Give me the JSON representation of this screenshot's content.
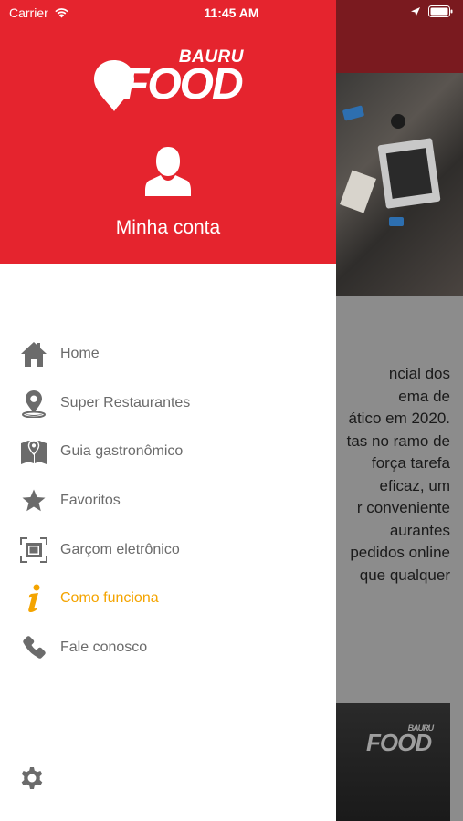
{
  "status_bar": {
    "carrier": "Carrier",
    "time": "11:45 AM"
  },
  "drawer": {
    "logo": {
      "top_text": "BAURU",
      "main_text": "FOOD"
    },
    "account_label": "Minha conta",
    "menu": [
      {
        "label": "Home",
        "icon": "home-icon",
        "active": false
      },
      {
        "label": "Super Restaurantes",
        "icon": "map-pin-icon",
        "active": false
      },
      {
        "label": "Guia gastronômico",
        "icon": "map-guide-icon",
        "active": false
      },
      {
        "label": "Favoritos",
        "icon": "star-icon",
        "active": false
      },
      {
        "label": "Garçom eletrônico",
        "icon": "scan-icon",
        "active": false
      },
      {
        "label": "Como funciona",
        "icon": "info-icon",
        "active": true
      },
      {
        "label": "Fale conosco",
        "icon": "phone-icon",
        "active": false
      }
    ],
    "settings_icon": "gear-icon"
  },
  "background": {
    "text_lines": [
      "ncial dos",
      "ema de",
      "ático em 2020.",
      "tas no ramo de",
      "força tarefa",
      "eficaz, um",
      "r conveniente",
      "aurantes",
      "pedidos online",
      "que qualquer"
    ],
    "card_logo": {
      "top_text": "BAURU",
      "main_text": "FOOD"
    }
  },
  "colors": {
    "brand_red": "#e5242e",
    "active_accent": "#f4a400",
    "menu_text": "#6b6b6b",
    "menu_icon": "#6b6b6b"
  }
}
